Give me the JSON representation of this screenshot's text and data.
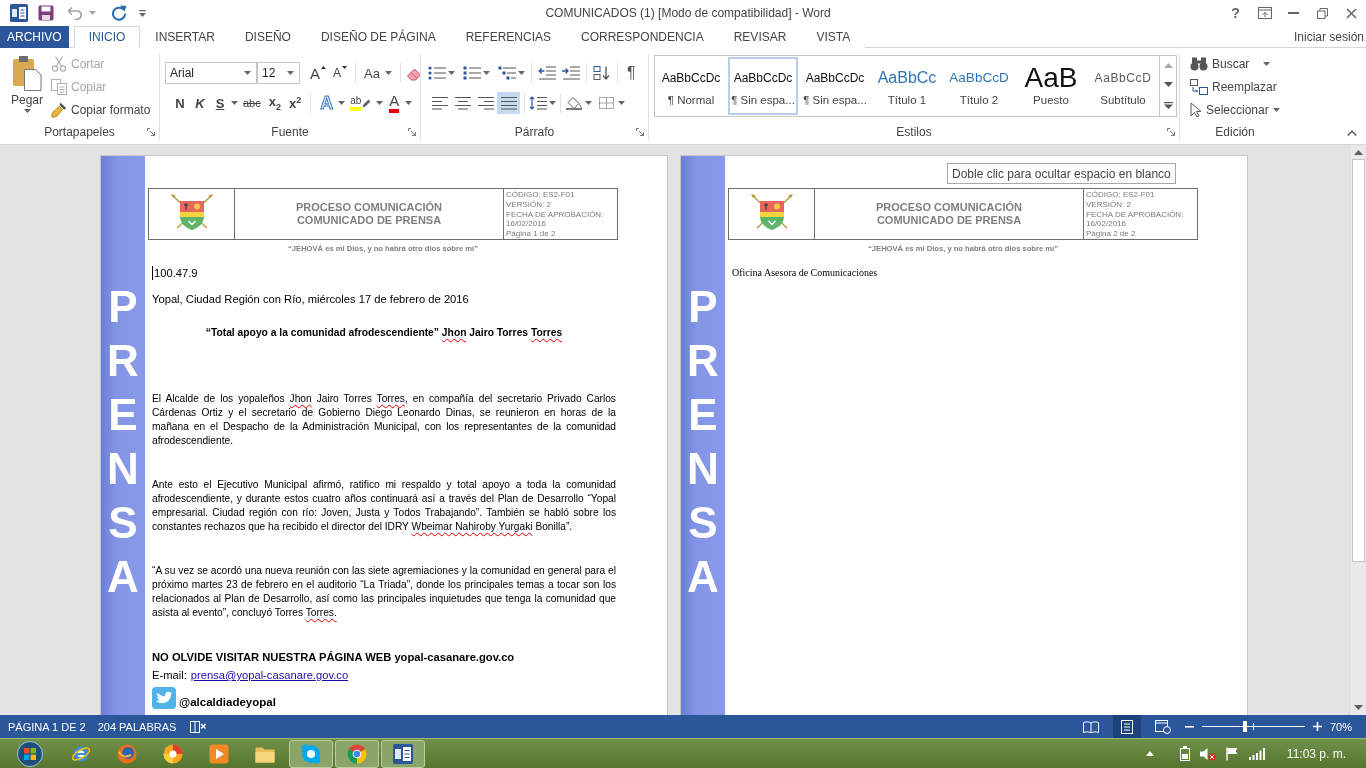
{
  "window": {
    "title": "COMUNICADOS (1) [Modo de compatibilidad] - Word",
    "help": "?"
  },
  "quick_access": {
    "undo": {
      "disabled": true
    }
  },
  "tabs": [
    {
      "label": "ARCHIVO",
      "kind": "file",
      "selected": false
    },
    {
      "label": "INICIO",
      "kind": "tab",
      "selected": true
    },
    {
      "label": "INSERTAR",
      "kind": "tab",
      "selected": false
    },
    {
      "label": "DISEÑO",
      "kind": "tab",
      "selected": false
    },
    {
      "label": "DISEÑO DE PÁGINA",
      "kind": "tab",
      "selected": false
    },
    {
      "label": "REFERENCIAS",
      "kind": "tab",
      "selected": false
    },
    {
      "label": "CORRESPONDENCIA",
      "kind": "tab",
      "selected": false
    },
    {
      "label": "REVISAR",
      "kind": "tab",
      "selected": false
    },
    {
      "label": "VISTA",
      "kind": "tab",
      "selected": false
    }
  ],
  "account": "Iniciar sesión",
  "ribbon": {
    "clipboard": {
      "label": "Portapapeles",
      "paste": "Pegar",
      "actions": [
        {
          "kind": "cut",
          "label": "Cortar",
          "disabled": true
        },
        {
          "kind": "copy",
          "label": "Copiar",
          "disabled": true
        },
        {
          "kind": "painter",
          "label": "Copiar formato",
          "disabled": false
        }
      ]
    },
    "font": {
      "label": "Fuente",
      "family": "Arial",
      "size": "12",
      "row1": [
        {
          "kind": "grow",
          "label": "A"
        },
        {
          "kind": "shrink",
          "label": "A"
        },
        {
          "kind": "case",
          "label": "Aa"
        },
        {
          "kind": "clear"
        }
      ],
      "row2": [
        {
          "kind": "bold",
          "label": "N"
        },
        {
          "kind": "italic",
          "label": "K"
        },
        {
          "kind": "underline",
          "label": "S"
        },
        {
          "kind": "strike",
          "label": "abc"
        },
        {
          "kind": "subscript",
          "label": "x$_{2}$"
        },
        {
          "kind": "superscript",
          "label": "x$^{2}$"
        },
        {
          "kind": "effects",
          "label": "A"
        },
        {
          "kind": "highlight",
          "label": "ab"
        },
        {
          "kind": "color",
          "label": "A"
        }
      ]
    },
    "paragraph": {
      "label": "Párrafo",
      "marks": "¶",
      "alignments": [
        {
          "kind": "left",
          "selected": false
        },
        {
          "kind": "center",
          "selected": false
        },
        {
          "kind": "right",
          "selected": false
        },
        {
          "kind": "justify",
          "selected": true
        }
      ]
    },
    "styles": {
      "label": "Estilos",
      "items": [
        {
          "kind": "normal",
          "preview": "AaBbCcDc",
          "name": "¶ Normal",
          "selected": false
        },
        {
          "kind": "normal",
          "preview": "AaBbCcDc",
          "name": "¶ Sin espa...",
          "selected": true
        },
        {
          "kind": "normal",
          "preview": "AaBbCcDc",
          "name": "¶ Sin espa...",
          "selected": false
        },
        {
          "kind": "heading1",
          "preview": "AaBbCc",
          "name": "Título 1",
          "selected": false
        },
        {
          "kind": "heading2",
          "preview": "AaBbCcD",
          "name": "Título 2",
          "selected": false
        },
        {
          "kind": "title",
          "preview": "AaB",
          "name": "Puesto",
          "selected": false
        },
        {
          "kind": "subtitle",
          "preview": "AaBbCcD",
          "name": "Subtítulo",
          "selected": false
        }
      ]
    },
    "editing": {
      "label": "Edición",
      "items": [
        {
          "kind": "find",
          "label": "Buscar"
        },
        {
          "kind": "replace",
          "label": "Reemplazar"
        },
        {
          "kind": "select",
          "label": "Seleccionar"
        }
      ]
    }
  },
  "pages": [
    {
      "band_text": "PRENSA",
      "header": {
        "title_lines": [
          "PROCESO COMUNICACIÓN",
          "COMUNICADO DE PRENSA"
        ],
        "info_lines": [
          "CÓDIGO: ES2-F01",
          "VERSIÓN: 2",
          "FECHA DE APROBACIÓN:",
          "16/02/2016",
          "Página 1 de 2"
        ]
      },
      "motto": "“JEHOVÁ es mi Dios, y no habrá otro dios sobre mí”",
      "blocks": [
        {
          "kind": "line",
          "text": "100.47.9",
          "cursor": true
        },
        {
          "kind": "line",
          "text": "Yopal, Ciudad Región con Río, miércoles 17 de febrero de 2016",
          "cursor": false
        },
        {
          "kind": "title",
          "cursor": false,
          "runs": [
            {
              "text": "“Total apoyo a la comunidad afrodescendiente” ",
              "misspelled": false
            },
            {
              "text": "Jhon",
              "misspelled": true
            },
            {
              "text": " Jairo Torres ",
              "misspelled": false
            },
            {
              "text": "Torres",
              "misspelled": true
            }
          ]
        },
        {
          "kind": "paragraph",
          "cursor": false,
          "runs": [
            {
              "text": "El Alcalde de los yopaleños ",
              "misspelled": false
            },
            {
              "text": "Jhon",
              "misspelled": true
            },
            {
              "text": " Jairo Torres ",
              "misspelled": false
            },
            {
              "text": "Torres",
              "misspelled": true
            },
            {
              "text": ", en compañía del secretario Privado Carlos Cárdenas Ortiz y el secretario de Gobierno Diego Leonardo Dinas, se reunieron en horas de la mañana en el Despacho de la Administración Municipal, con los representantes de la comunidad afrodescendiente.",
              "misspelled": false
            }
          ]
        },
        {
          "kind": "paragraph",
          "cursor": false,
          "runs": [
            {
              "text": "Ante esto el Ejecutivo Municipal afirmó, ratifico mi respaldo y total apoyo a toda la comunidad afrodescendiente, y durante estos cuatro años continuará así a través del Plan de Desarrollo “Yopal empresarial. Ciudad región con río: Joven, Justa y Todos Trabajando”. También se habló sobre los constantes rechazos que ha recibido el director del IDRY ",
              "misspelled": false
            },
            {
              "text": "Wbeimar Nahiroby Yurgaki",
              "misspelled": true
            },
            {
              "text": " Bonilla”.",
              "misspelled": false
            }
          ]
        },
        {
          "kind": "paragraph",
          "cursor": false,
          "runs": [
            {
              "text": "“A su vez se acordó una nueva reunión con las siete agremiaciones y la comunidad en general para el próximo martes 23 de febrero en el auditorio “La Triada”, donde los principales temas a tocar son los relacionados al Plan de Desarrollo, así como las principales inquietudes que tenga la comunidad que asista al evento”, concluyó Torres ",
              "misspelled": false
            },
            {
              "text": "Torres.",
              "misspelled": true
            }
          ]
        },
        {
          "kind": "notice",
          "text": "NO OLVIDE VISITAR NUESTRA PÁGINA WEB yopal-casanare.gov.co",
          "cursor": false
        },
        {
          "kind": "email",
          "label": "E-mail:",
          "link": "prensa@yopal-casanare.gov.co",
          "cursor": false
        },
        {
          "kind": "social",
          "text": "@alcaldiadeyopal",
          "cursor": false
        }
      ]
    },
    {
      "band_text": "PRENSA",
      "tooltip": "Doble clic para ocultar espacio en blanco",
      "header": {
        "title_lines": [
          "PROCESO COMUNICACIÓN",
          "COMUNICADO DE PRENSA"
        ],
        "info_lines": [
          "CÓDIGO: ES2-F01",
          "VERSIÓN: 2",
          "FECHA DE APROBACIÓN:",
          "16/02/2016",
          "Página 2 de 2"
        ]
      },
      "motto": "“JEHOVÁ es mi Dios, y no habrá otro dios sobre mí”",
      "blocks": [
        {
          "kind": "serif",
          "text": "Oficina Asesora de Comunicaciones",
          "cursor": false
        }
      ]
    }
  ],
  "status_bar": {
    "page": "PÁGINA 1 DE 2",
    "words": "204 PALABRAS",
    "views": [
      {
        "kind": "read",
        "selected": false
      },
      {
        "kind": "print",
        "selected": true
      },
      {
        "kind": "web",
        "selected": false
      }
    ],
    "zoom": {
      "level": 0.42,
      "reading": "70%"
    }
  },
  "taskbar": {
    "apps": [
      {
        "kind": "globe",
        "running": false
      },
      {
        "kind": "fox",
        "running": false
      },
      {
        "kind": "swirl",
        "running": false
      },
      {
        "kind": "play",
        "running": false
      },
      {
        "kind": "folder",
        "running": false
      },
      {
        "kind": "cloud",
        "running": true
      },
      {
        "kind": "wheel",
        "running": true
      },
      {
        "kind": "document",
        "running": true
      }
    ],
    "clock": "11:03 p. m."
  }
}
